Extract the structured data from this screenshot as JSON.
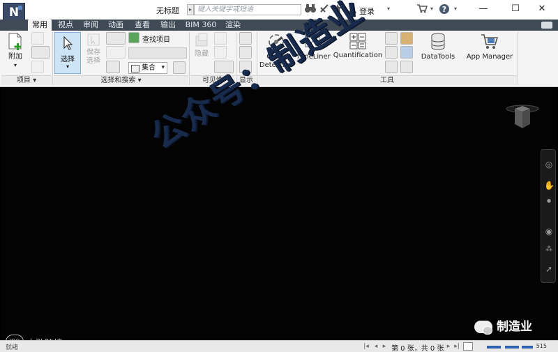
{
  "window": {
    "app_button": "N",
    "title": "无标题",
    "search_placeholder": "键入关键字或短语",
    "login": "登录",
    "controls": {
      "minimize": "—",
      "maximize": "☐",
      "close": "✕"
    }
  },
  "tabs": [
    {
      "label": "常用",
      "active": true
    },
    {
      "label": "视点"
    },
    {
      "label": "审阅"
    },
    {
      "label": "动画"
    },
    {
      "label": "查看"
    },
    {
      "label": "输出"
    },
    {
      "label": "BIM 360"
    },
    {
      "label": "渲染"
    }
  ],
  "ribbon": {
    "project": {
      "append": "附加",
      "footer": "项目 ▾"
    },
    "select_search": {
      "select": "选择",
      "save_selection_line1": "保存",
      "save_selection_line2": "选择",
      "find_items": "查找项目",
      "sets": "集合",
      "footer": "选择和搜索 ▾"
    },
    "visibility": {
      "hide": "隐藏",
      "footer": "可见性"
    },
    "display": {
      "footer": "显示"
    },
    "tools": {
      "clash_line1": "Clash",
      "clash_line2": "Detective",
      "timeliner": "TimeLiner",
      "quantification": "Quantification",
      "datatools": "DataTools",
      "app_manager": "App Manager",
      "footer": "工具"
    }
  },
  "viewport": {
    "watermark": "公众号：制造业"
  },
  "overlay": {
    "brand": "制造业",
    "bigdata": "大数跨境",
    "bigdata_logo": "IDO"
  },
  "status": {
    "left": "就绪",
    "page": "第 0 张，共 0 张",
    "memory": "515"
  },
  "colors": {
    "tab_bar": "#3f4a56",
    "ribbon": "#f4f4f4",
    "select_active": "#cde3f6",
    "viewport": "#030303",
    "watermark": "#182b4c"
  }
}
